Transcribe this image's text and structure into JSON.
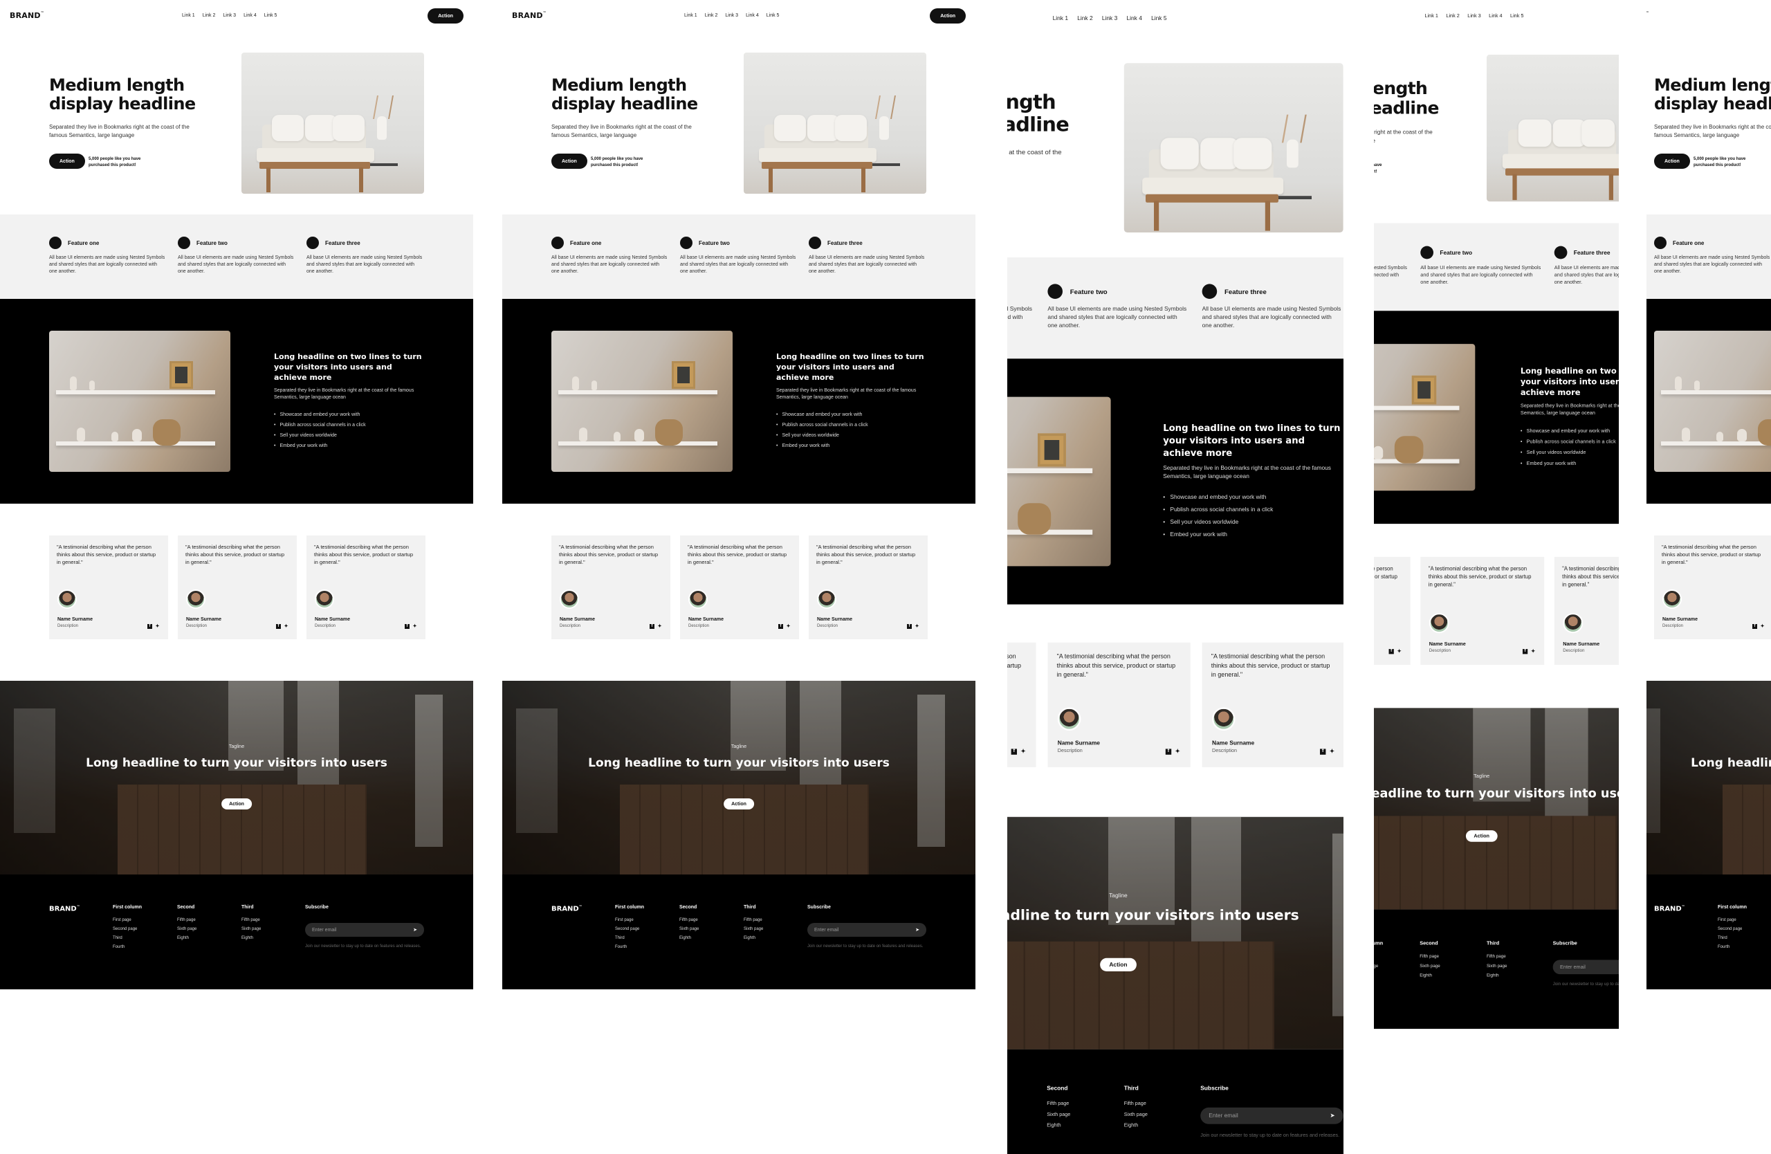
{
  "nav": {
    "brand": "BRAND",
    "tm": "™",
    "links": [
      "Link 1",
      "Link 2",
      "Link 3",
      "Link 4",
      "Link 5"
    ],
    "action": "Action"
  },
  "hero": {
    "title": "Medium length display headline",
    "subtitle": "Separated they live in Bookmarks right at the coast of the famous Semantics, large language",
    "action": "Action",
    "social_proof": "5,000 people like you have purchased this product!"
  },
  "features": [
    {
      "title": "Feature one",
      "text": "All base UI elements are made using Nested Symbols and shared styles that are logically connected with one another."
    },
    {
      "title": "Feature two",
      "text": "All base UI elements are made using Nested Symbols and shared styles that are logically connected with one another."
    },
    {
      "title": "Feature three",
      "text": "All base UI elements are made using Nested Symbols and shared styles that are logically connected with one another."
    }
  ],
  "dark": {
    "title": "Long headline on two lines to turn your visitors into users and achieve more",
    "subtitle": "Separated they live in Bookmarks right at the coast of the famous Semantics, large language ocean",
    "bullets": [
      "Showcase and embed your work with",
      "Publish across social channels in a click",
      "Sell your videos worldwide",
      "Embed your work with"
    ]
  },
  "testimonials": [
    {
      "quote": "\"A testimonial describing what the person thinks about this service, product or startup in general.\"",
      "name": "Name Surname",
      "desc": "Description"
    },
    {
      "quote": "\"A testimonial describing what the person thinks about this service, product or startup in general.\"",
      "name": "Name Surname",
      "desc": "Description"
    },
    {
      "quote": "\"A testimonial describing what the person thinks about this service, product or startup in general.\"",
      "name": "Name Surname",
      "desc": "Description"
    }
  ],
  "cta": {
    "tagline": "Tagline",
    "title": "Long headline to turn your visitors into users",
    "action": "Action"
  },
  "footer": {
    "brand": "BRAND",
    "columns": [
      {
        "title": "First column",
        "links": [
          "First page",
          "Second page",
          "Third",
          "Fourth"
        ]
      },
      {
        "title": "Second",
        "links": [
          "Fifth page",
          "Sixth page",
          "Eighth"
        ]
      },
      {
        "title": "Third",
        "links": [
          "Fifth page",
          "Sixth page",
          "Eighth"
        ]
      }
    ],
    "subscribe": {
      "title": "Subscribe",
      "placeholder": "Enter email",
      "note": "Join our newsletter to stay up to date on features and releases."
    }
  },
  "social_icons": [
    "facebook-icon",
    "twitter-icon"
  ]
}
